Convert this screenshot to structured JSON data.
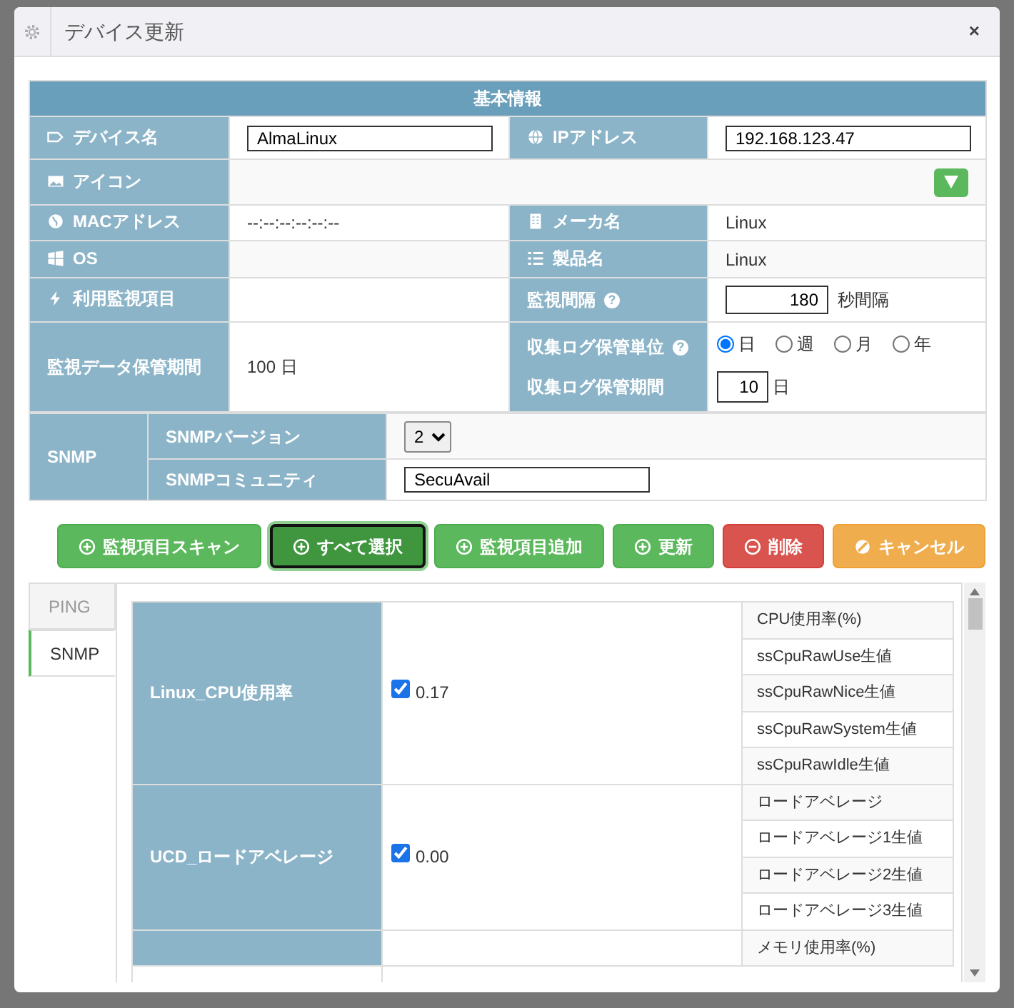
{
  "window": {
    "title": "デバイス更新",
    "close": "×"
  },
  "info": {
    "header": "基本情報",
    "device_name": {
      "label": "デバイス名",
      "value": "AlmaLinux"
    },
    "ip_address": {
      "label": "IPアドレス",
      "value": "192.168.123.47"
    },
    "icon": {
      "label": "アイコン"
    },
    "mac": {
      "label": "MACアドレス",
      "value": "--:--:--:--:--:--"
    },
    "maker": {
      "label": "メーカ名",
      "value": "Linux"
    },
    "os": {
      "label": "OS"
    },
    "product": {
      "label": "製品名",
      "value": "Linux"
    },
    "monitor_items": {
      "label": "利用監視項目"
    },
    "interval": {
      "label": "監視間隔",
      "help": "?",
      "value": "180",
      "unit": "秒間隔"
    },
    "retention": {
      "label": "監視データ保管期間",
      "value": "100 日"
    },
    "log_unit": {
      "label": "収集ログ保管単位",
      "help": "?",
      "options": [
        {
          "label": "日",
          "selected": true
        },
        {
          "label": "週",
          "selected": false
        },
        {
          "label": "月",
          "selected": false
        },
        {
          "label": "年",
          "selected": false
        }
      ]
    },
    "log_period": {
      "label": "収集ログ保管期間",
      "value": "10",
      "unit": "日"
    },
    "snmp": {
      "label": "SNMP",
      "version_label": "SNMPバージョン",
      "version_value": "2",
      "community_label": "SNMPコミュニティ",
      "community_value": "SecuAvail"
    }
  },
  "buttons": [
    {
      "label": "監視項目スキャン",
      "kind": "add",
      "focused": false
    },
    {
      "label": "すべて選択",
      "kind": "add",
      "focused": true
    },
    {
      "label": "監視項目追加",
      "kind": "add",
      "focused": false
    },
    {
      "label": "更新",
      "kind": "add",
      "focused": false
    },
    {
      "label": "削除",
      "kind": "remove",
      "focused": false
    },
    {
      "label": "キャンセル",
      "kind": "cancel",
      "focused": false
    }
  ],
  "tabs": [
    {
      "label": "PING",
      "selected": false
    },
    {
      "label": "SNMP",
      "selected": true
    }
  ],
  "items": [
    {
      "name": "Linux_CPU使用率",
      "checked": true,
      "value": "0.17",
      "metrics": [
        "CPU使用率(%)",
        "ssCpuRawUse生値",
        "ssCpuRawNice生値",
        "ssCpuRawSystem生値",
        "ssCpuRawIdle生値"
      ]
    },
    {
      "name": "UCD_ロードアベレージ",
      "checked": true,
      "value": "0.00",
      "metrics": [
        "ロードアベレージ",
        "ロードアベレージ1生値",
        "ロードアベレージ2生値",
        "ロードアベレージ3生値"
      ]
    },
    {
      "metrics": [
        "メモリ使用率(%)"
      ]
    }
  ]
}
